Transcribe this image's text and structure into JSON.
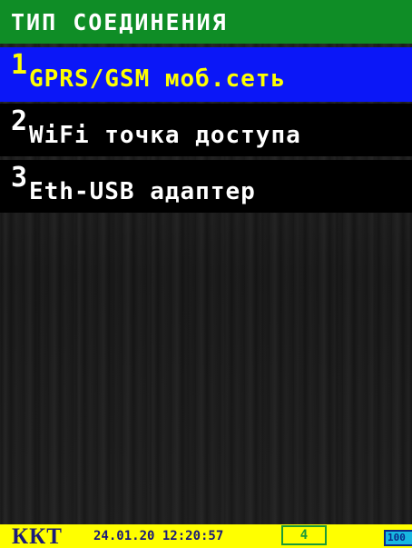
{
  "header": {
    "title": "ТИП СОЕДИНЕНИЯ"
  },
  "menu": {
    "items": [
      {
        "number": "1",
        "label": "GPRS/GSM моб.сеть",
        "selected": true
      },
      {
        "number": "2",
        "label": "WiFi точка доступа",
        "selected": false
      },
      {
        "number": "3",
        "label": "Eth-USB адаптер",
        "selected": false
      }
    ]
  },
  "status_bar": {
    "device_label": "ККТ",
    "datetime": "24.01.20 12:20:57",
    "counter": "4",
    "battery_percent": "100"
  },
  "colors": {
    "title_bg": "#0f8d26",
    "selected_bg": "#0b17f7",
    "selected_text": "#ffff00",
    "status_bg": "#ffff00",
    "battery_fill": "#17b7e0"
  }
}
